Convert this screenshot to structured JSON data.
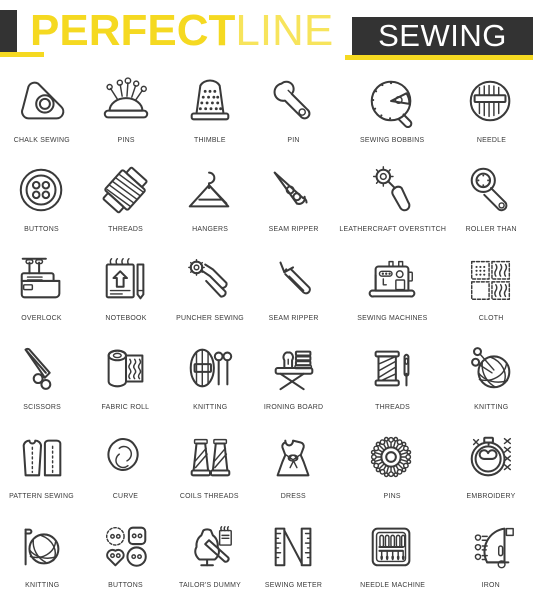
{
  "header": {
    "title_bold": "PERFECT",
    "title_light": "LINE",
    "badge": "SEWING",
    "colors": {
      "yellow": "#f5d921",
      "dark": "#333333",
      "stroke": "#3a3a3a",
      "label": "#3b3b3b",
      "background": "#ffffff"
    }
  },
  "grid": {
    "columns": 6,
    "rows": 6,
    "icons": [
      {
        "label": "CHALK SEWING",
        "icon": "chalk-sewing-icon"
      },
      {
        "label": "PINS",
        "icon": "pin-cushion-icon"
      },
      {
        "label": "THIMBLE",
        "icon": "thimble-icon"
      },
      {
        "label": "PIN",
        "icon": "safety-pin-icon"
      },
      {
        "label": "SEWING BOBBINS",
        "icon": "sewing-bobbin-icon"
      },
      {
        "label": "NEEDLE",
        "icon": "needle-pack-icon"
      },
      {
        "label": "BUTTONS",
        "icon": "button-icon"
      },
      {
        "label": "THREADS",
        "icon": "thread-spool-diagonal-icon"
      },
      {
        "label": "HANGERS",
        "icon": "hanger-icon"
      },
      {
        "label": "SEAM RIPPER",
        "icon": "seam-ripper-shears-icon"
      },
      {
        "label": "LEATHERCRAFT OVERSTITCH",
        "icon": "overstitch-wheel-icon"
      },
      {
        "label": "ROLLER THAN",
        "icon": "rotary-cutter-icon"
      },
      {
        "label": "OVERLOCK",
        "icon": "overlock-machine-icon"
      },
      {
        "label": "NOTEBOOK",
        "icon": "notebook-pencil-icon"
      },
      {
        "label": "PUNCHER SEWING",
        "icon": "puncher-pliers-icon"
      },
      {
        "label": "SEAM RIPPER",
        "icon": "seam-ripper-tool-icon"
      },
      {
        "label": "SEWING MACHINES",
        "icon": "sewing-machine-icon"
      },
      {
        "label": "CLOTH",
        "icon": "cloth-swatches-icon"
      },
      {
        "label": "SCISSORS",
        "icon": "scissors-icon"
      },
      {
        "label": "FABRIC ROLL",
        "icon": "fabric-roll-icon"
      },
      {
        "label": "KNITTING",
        "icon": "knitting-needles-yarn-icon"
      },
      {
        "label": "IRONING BOARD",
        "icon": "ironing-board-icon"
      },
      {
        "label": "THREADS",
        "icon": "thread-spool-needle-icon"
      },
      {
        "label": "KNITTING",
        "icon": "yarn-ball-pins-icon"
      },
      {
        "label": "PATTERN SEWING",
        "icon": "pattern-pieces-icon"
      },
      {
        "label": "CURVE",
        "icon": "french-curve-icon"
      },
      {
        "label": "COILS THREADS",
        "icon": "thread-cones-icon"
      },
      {
        "label": "DRESS",
        "icon": "dress-icon"
      },
      {
        "label": "PINS",
        "icon": "pin-wheel-icon"
      },
      {
        "label": "EMBROIDERY",
        "icon": "embroidery-hoop-icon"
      },
      {
        "label": "KNITTING",
        "icon": "yarn-ball-needle-icon"
      },
      {
        "label": "BUTTONS",
        "icon": "buttons-shapes-icon"
      },
      {
        "label": "TAILOR'S DUMMY",
        "icon": "tailors-dummy-icon"
      },
      {
        "label": "SEWING METER",
        "icon": "sewing-meter-icon"
      },
      {
        "label": "NEEDLE MACHINE",
        "icon": "needle-machine-icon"
      },
      {
        "label": "IRON",
        "icon": "iron-icon"
      }
    ]
  }
}
